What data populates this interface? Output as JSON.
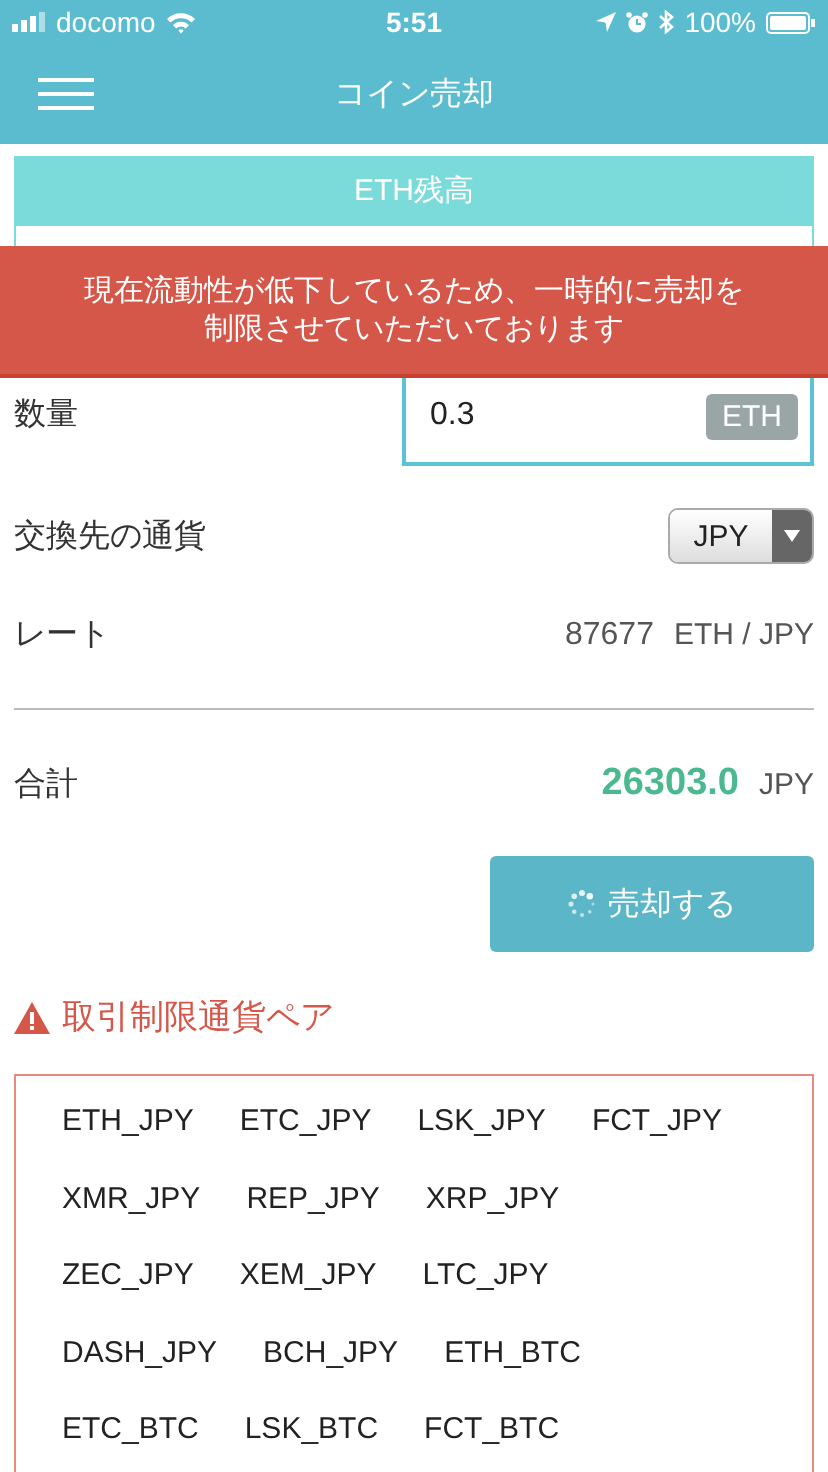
{
  "status_bar": {
    "carrier": "docomo",
    "time": "5:51",
    "battery": "100%"
  },
  "header": {
    "title": "コイン売却"
  },
  "balance_card": {
    "title": "ETH残高"
  },
  "alert_banner": {
    "message": "現在流動性が低下しているため、一時的に売却を制限させていただいております"
  },
  "form": {
    "quantity": {
      "label": "数量",
      "value": "0.3",
      "unit": "ETH"
    },
    "currency": {
      "label": "交換先の通貨",
      "value": "JPY"
    },
    "rate": {
      "label": "レート",
      "value": "87677",
      "unit": "ETH / JPY"
    },
    "total": {
      "label": "合計",
      "value": "26303.0",
      "unit": "JPY"
    },
    "sell_button": {
      "label": "売却する"
    }
  },
  "restricted": {
    "title": "取引制限通貨ペア",
    "rows": [
      [
        "ETH_JPY",
        "ETC_JPY",
        "LSK_JPY",
        "FCT_JPY"
      ],
      [
        "XMR_JPY",
        "REP_JPY",
        "XRP_JPY"
      ],
      [
        "ZEC_JPY",
        "XEM_JPY",
        "LTC_JPY"
      ],
      [
        "DASH_JPY",
        "BCH_JPY",
        "ETH_BTC"
      ],
      [
        "ETC_BTC",
        "LSK_BTC",
        "FCT_BTC"
      ]
    ]
  }
}
